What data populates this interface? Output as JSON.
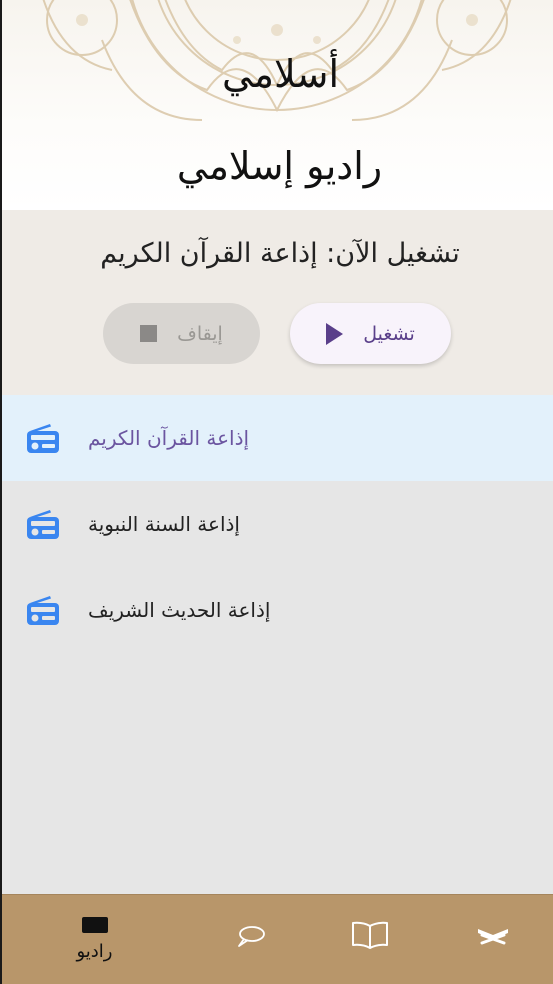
{
  "header": {
    "app_title": "أسلامي",
    "page_title": "راديو إسلامي"
  },
  "now_playing": {
    "text": "تشغيل الآن: إذاعة القرآن الكريم",
    "play_label": "تشغيل",
    "stop_label": "إيقاف"
  },
  "stations": [
    {
      "name": "إذاعة القرآن الكريم",
      "active": true
    },
    {
      "name": "إذاعة السنة النبوية",
      "active": false
    },
    {
      "name": "إذاعة الحديث الشريف",
      "active": false
    }
  ],
  "bottom_nav": {
    "items": [
      {
        "icon": "radio-icon",
        "label": "راديو",
        "active": true
      },
      {
        "icon": "chat-bubble-icon",
        "label": "",
        "active": false
      },
      {
        "icon": "open-book-icon",
        "label": "",
        "active": false
      },
      {
        "icon": "quran-stand-icon",
        "label": "",
        "active": false
      }
    ]
  },
  "colors": {
    "accent": "#5a3f8a",
    "radio_icon": "#3a86f0",
    "nav_bg": "#b8966a",
    "active_row_bg": "#e3f1fb"
  }
}
